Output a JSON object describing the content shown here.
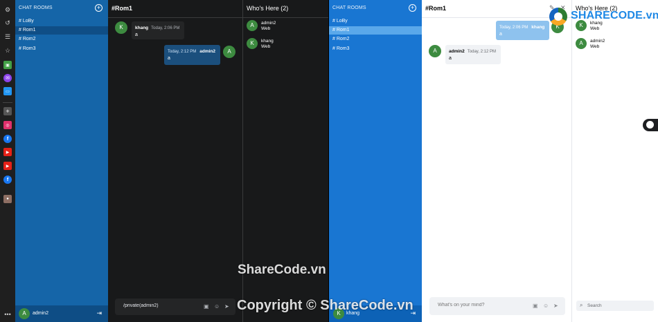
{
  "left_app": {
    "sidebar": {
      "header": "CHAT ROOMS",
      "rooms": [
        "# LoBy",
        "# Rom1",
        "# Rom2",
        "# Rom3"
      ],
      "active_index": 1,
      "footer_user": {
        "initial": "A",
        "name": "admin2"
      }
    },
    "chat": {
      "title": "#Rom1",
      "messages": [
        {
          "initial": "K",
          "name": "khang",
          "time": "Today, 2:06 PM",
          "text": "a",
          "own": false
        },
        {
          "initial": "A",
          "name": "admin2",
          "time": "Today, 2:12 PM",
          "text": "a",
          "own": true
        }
      ],
      "composer_value": "/private(admin2)"
    },
    "who": {
      "title": "Who's Here (2)",
      "users": [
        {
          "initial": "A",
          "name": "admin2",
          "sub": "Web"
        },
        {
          "initial": "K",
          "name": "khang",
          "sub": "Web"
        }
      ]
    }
  },
  "right_app": {
    "sidebar": {
      "header": "CHAT ROOMS",
      "rooms": [
        "# LoBy",
        "# Rom1",
        "# Rom2",
        "# Rom3"
      ],
      "active_index": 1,
      "footer_user": {
        "initial": "K",
        "name": "khang"
      }
    },
    "chat": {
      "title": "#Rom1",
      "messages": [
        {
          "initial": "K",
          "name": "khang",
          "time": "Today, 2:06 PM",
          "text": "a",
          "own": true
        },
        {
          "initial": "A",
          "name": "admin2",
          "time": "Today, 2:12 PM",
          "text": "a",
          "own": false
        }
      ],
      "composer_placeholder": "What's on your mind?"
    },
    "who": {
      "title": "Who's Here (2)",
      "users": [
        {
          "initial": "K",
          "name": "khang",
          "sub": "Web"
        },
        {
          "initial": "A",
          "name": "admin2",
          "sub": "Web"
        }
      ],
      "search_placeholder": "Search"
    }
  },
  "watermarks": {
    "logo_text": "SHARECODE.vn",
    "center_text": "ShareCode.vn",
    "copyright_text": "Copyright © ShareCode.vn"
  },
  "colors": {
    "sidebar_dark": "#1565a8",
    "sidebar_light": "#1976d2",
    "chat_dark": "#18191a",
    "own_bubble_dark": "#1b4f7d",
    "own_bubble_light": "#8ec2ee",
    "avatar": "#3d8b40"
  },
  "browser_strip_icons": [
    "settings-icon",
    "history-icon",
    "reading-list-icon",
    "star-icon",
    "app-icon",
    "messenger-icon",
    "chat-app-icon",
    "add-icon",
    "instagram-icon",
    "facebook-icon",
    "youtube-icon",
    "youtube-icon",
    "facebook-icon",
    "profile-icon",
    "more-icon"
  ]
}
